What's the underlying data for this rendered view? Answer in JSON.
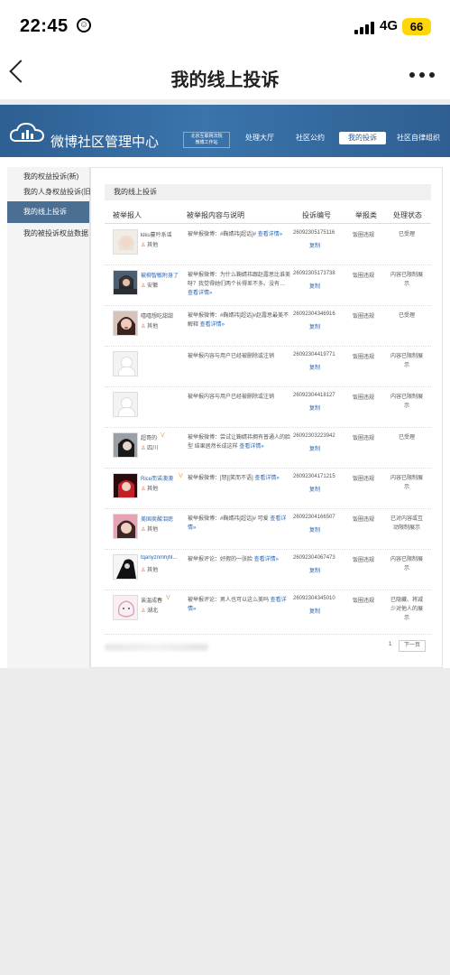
{
  "status_bar": {
    "time": "22:45",
    "network": "4G",
    "battery": "66"
  },
  "nav": {
    "title": "我的线上投诉"
  },
  "site": {
    "brand": "微博社区管理中心",
    "org_line1": "北京互联网法院",
    "org_line2": "微博工作站",
    "menu": [
      "处理大厅",
      "社区公约",
      "我的投诉",
      "社区自律组织"
    ],
    "active_menu": "我的投诉"
  },
  "sidebar": {
    "items": [
      "我的权益投诉(新)",
      "我的人身权益投诉(旧)",
      "我的线上投诉",
      "我的被投诉权益数据"
    ]
  },
  "panel": {
    "title": "我的线上投诉",
    "columns": [
      "被举报人",
      "被举报内容与说明",
      "投诉编号",
      "举报类",
      "处理状态"
    ]
  },
  "rows": [
    {
      "user": "kiku蔓吟系谣",
      "location": "其他",
      "content": "被举报微博：#鞠婧祎[超话]# ",
      "more": "查看详情»",
      "id": "26092305175116",
      "copy": "复制",
      "type": "饭圈违规",
      "status": "已受理"
    },
    {
      "user": "被柳智敏附身了",
      "location": "安徽",
      "content": "被举报微博：为什么鞠婧祎跟赵露思比谁美呀？我觉得她们两个长得差不多。没有…",
      "more": "查看详情»",
      "id": "26092305173738",
      "copy": "复制",
      "type": "饭圈违规",
      "status": "内容已限制展示"
    },
    {
      "user": "嘻嘻想吃甜甜",
      "location": "其他",
      "content": "被举报微博：#鞠婧祎[超话]#赵露思最美不解释 ",
      "more": "查看详情»",
      "id": "26092304346916",
      "copy": "复制",
      "type": "饭圈违规",
      "status": "已受理"
    },
    {
      "user": "",
      "location": "",
      "content": "被举报内容与用户已经被删除或注销",
      "more": "",
      "id": "26092304419771",
      "copy": "复制",
      "type": "饭圈违规",
      "status": "内容已限制展示"
    },
    {
      "user": "",
      "location": "",
      "content": "被举报内容与用户已经被删除或注销",
      "more": "",
      "id": "26092304418127",
      "copy": "复制",
      "type": "饭圈违规",
      "status": "内容已限制展示"
    },
    {
      "user": "超哥的",
      "location": "四川",
      "content": "被举报微博：尝试让鞠婧祎拥有普通人的脸型 结果居然长成这样 ",
      "more": "查看详情»",
      "id": "26092303223942",
      "copy": "复制",
      "type": "饭圈违规",
      "status": "已受理"
    },
    {
      "user": "Rice而诺澳澳",
      "location": "其他",
      "content": "被举报微博：[怒][笑而不语] ",
      "more": "查看详情»",
      "id": "26092304171215",
      "copy": "复制",
      "type": "饭圈违规",
      "status": "内容已限制展示"
    },
    {
      "user": "美国卖酸泪痣",
      "location": "其他",
      "content": "被举报微博：#鞠婧祎[超话]# 可爱 ",
      "more": "查看详情»",
      "id": "26092304166507",
      "copy": "复制",
      "type": "饭圈违规",
      "status": "已对内容或互动限制展示"
    },
    {
      "user": "tqanyznmhjhl...",
      "location": "其他",
      "content": "被举报评论：好假的一张脸 ",
      "more": "查看详情»",
      "id": "26092304067473",
      "copy": "复制",
      "type": "饭圈违规",
      "status": "内容已限制展示"
    },
    {
      "user": "诶温成春",
      "location": "湖北",
      "content": "被举报评论：男人也可以这么美吗 ",
      "more": "查看详情»",
      "id": "26092304345010",
      "copy": "复制",
      "type": "饭圈违规",
      "status": "已隐藏、将减少对他人的展示"
    }
  ],
  "pager": {
    "page": "1",
    "next": "下一页"
  },
  "colors": {
    "banner": "#3a74ab",
    "sidebar_active": "#4a6f93",
    "link": "#2a66b1",
    "battery": "#ffd60a"
  },
  "icons": [
    "back-icon",
    "more-icon",
    "cloud-logo-icon",
    "location-pin-icon",
    "verified-badge-icon"
  ]
}
